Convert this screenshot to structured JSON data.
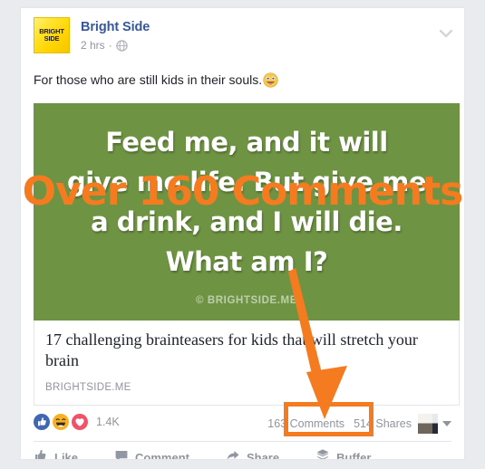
{
  "post": {
    "page_name": "Bright Side",
    "avatar_line1": "BRIGHT",
    "avatar_line2": "SIDE",
    "timestamp": "2 hrs",
    "meta_separator": "·",
    "privacy_icon": "globe-icon",
    "menu_icon": "chevron-down-icon",
    "message": "For those who are still kids in their souls.",
    "message_emoji": "face-with-tongue-emoji"
  },
  "attachment": {
    "image_lines": [
      "Feed me, and it will",
      "give me life. But give me",
      "a drink, and I will die.",
      "What am I?"
    ],
    "watermark": "© BRIGHTSIDE.ME",
    "background_color": "#6e9443",
    "link_title": "17 challenging brainteasers for kids that will stretch your brain",
    "link_domain": "BRIGHTSIDE.ME"
  },
  "engagement": {
    "reaction_icons": [
      "like-icon",
      "haha-icon",
      "love-icon"
    ],
    "reaction_count": "1.4K",
    "comments": "163 Comments",
    "shares": "514 Shares",
    "thumbnail_icon": "shared-post-thumbnail",
    "more_icon": "caret-down-icon"
  },
  "actions": [
    {
      "label": "Like",
      "icon": "thumbs-up-icon"
    },
    {
      "label": "Comment",
      "icon": "speech-bubble-icon"
    },
    {
      "label": "Share",
      "icon": "share-arrow-icon"
    },
    {
      "label": "Buffer",
      "icon": "buffer-layers-icon"
    }
  ],
  "annotations": {
    "callout_text": "Over 160 Comments",
    "accent_color": "#f47b20",
    "outline_color": "#000000",
    "arrow_icon": "orange-arrow-icon",
    "highlight_box_target": "163 Comments"
  }
}
